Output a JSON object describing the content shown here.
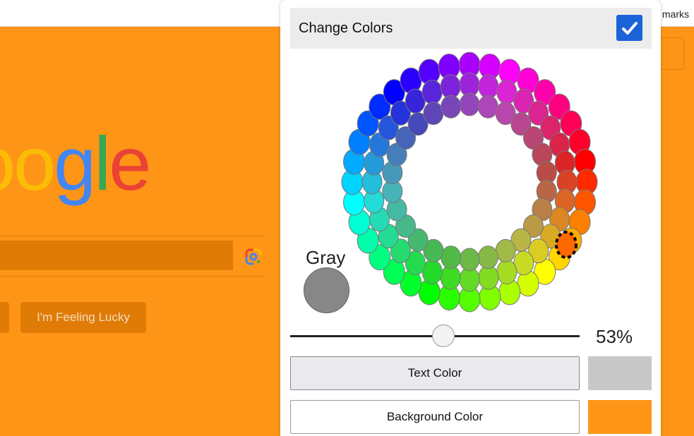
{
  "browser": {
    "bookmarks_label": "marks"
  },
  "google": {
    "logo_letters": [
      {
        "ch": "o",
        "color": "#fbbc05"
      },
      {
        "ch": "o",
        "color": "#fbbc05"
      },
      {
        "ch": "g",
        "color": "#4285f4"
      },
      {
        "ch": "l",
        "color": "#34a853"
      },
      {
        "ch": "e",
        "color": "#ea4335"
      }
    ],
    "lucky_label": "I'm Feeling Lucky",
    "lens_icon": "google-lens-icon"
  },
  "panel": {
    "title": "Change Colors",
    "enabled": true,
    "checkbox_icon": "checkmark-icon",
    "gray_label": "Gray",
    "gray_color": "#878787",
    "selected_color": "#ff6a00",
    "slider_value": 0.53,
    "percent_label": "53%",
    "text_color_button": "Text Color",
    "text_color_value": "#c8c8c8",
    "background_color_button": "Background Color",
    "background_color_value": "#ff9516"
  }
}
